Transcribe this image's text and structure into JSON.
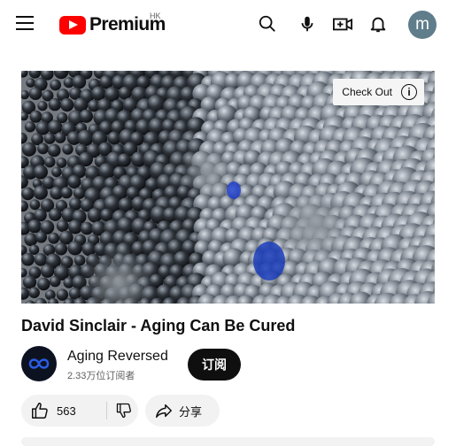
{
  "header": {
    "logo_text": "Premium",
    "region": "HK",
    "icons": [
      "menu-icon",
      "youtube-logo-icon",
      "search-icon",
      "mic-icon",
      "create-video-icon",
      "notifications-icon"
    ],
    "avatar_letter": "m",
    "avatar_color": "#607d8b"
  },
  "video": {
    "overlay_label": "Check Out",
    "overlay_icon": "info-icon"
  },
  "details": {
    "title": "David Sinclair - Aging Can Be Cured",
    "channel_name": "Aging Reversed",
    "subscribers": "2.33万位订阅者",
    "subscribe_label": "订阅",
    "like_count": "563",
    "share_label": "分享"
  },
  "colors": {
    "brand_red": "#ff0000",
    "subscribe_bg": "#0f0f0f",
    "pill_bg": "#f2f2f2"
  }
}
